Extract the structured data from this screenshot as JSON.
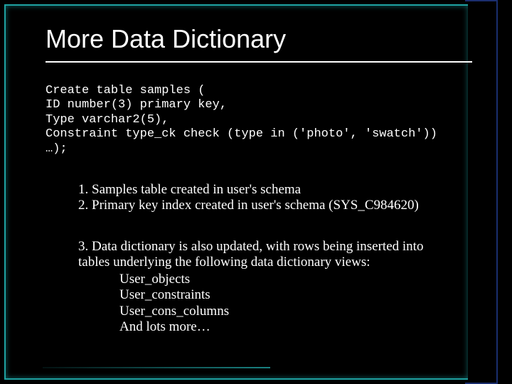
{
  "title": "More Data Dictionary",
  "code": {
    "l1": "Create table samples (",
    "l2": "ID number(3) primary key,",
    "l3": "Type varchar2(5),",
    "l4": "Constraint type_ck check (type in ('photo', 'swatch'))",
    "l5": "…);"
  },
  "notes1": {
    "n1": "1. Samples table created in user's schema",
    "n2": "2. Primary key index created in user's schema (SYS_C984620)"
  },
  "notes2": {
    "intro1": "3. Data dictionary is also updated, with rows being inserted into",
    "intro2": "tables underlying the following data dictionary views:"
  },
  "views": {
    "v1": "User_objects",
    "v2": "User_constraints",
    "v3": "User_cons_columns",
    "v4": "And lots more…"
  }
}
